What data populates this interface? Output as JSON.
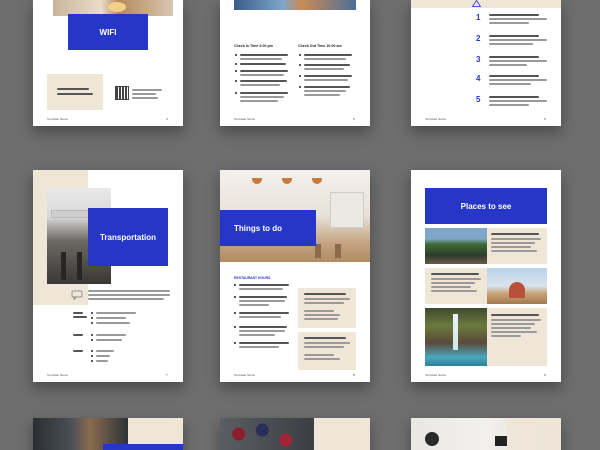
{
  "pages": {
    "wifi": {
      "heading": "WIFI",
      "footer": "Template Name",
      "page_no": "4"
    },
    "checkin": {
      "col1_title": "Check In Time 4:00 pm",
      "col2_title": "Check Out Time 10:00 am",
      "footer": "Template Name",
      "page_no": "5"
    },
    "list": {
      "numbers": [
        "1",
        "2",
        "3",
        "4",
        "5"
      ],
      "footer": "Template Name",
      "page_no": "6"
    },
    "transport": {
      "heading": "Transportation",
      "footer": "Template Name",
      "page_no": "7"
    },
    "things": {
      "heading": "Things to do",
      "subheading": "RESTAURANT HOURS",
      "footer": "Template Name",
      "page_no": "8"
    },
    "places": {
      "heading": "Places to see",
      "footer": "Template Name",
      "page_no": "9"
    }
  },
  "colors": {
    "accent": "#2637c8",
    "beige": "#efe6d8",
    "background": "#6e6e6e"
  },
  "icons": [
    "qr-code-icon",
    "warning-icon",
    "chat-bubble-icon"
  ]
}
